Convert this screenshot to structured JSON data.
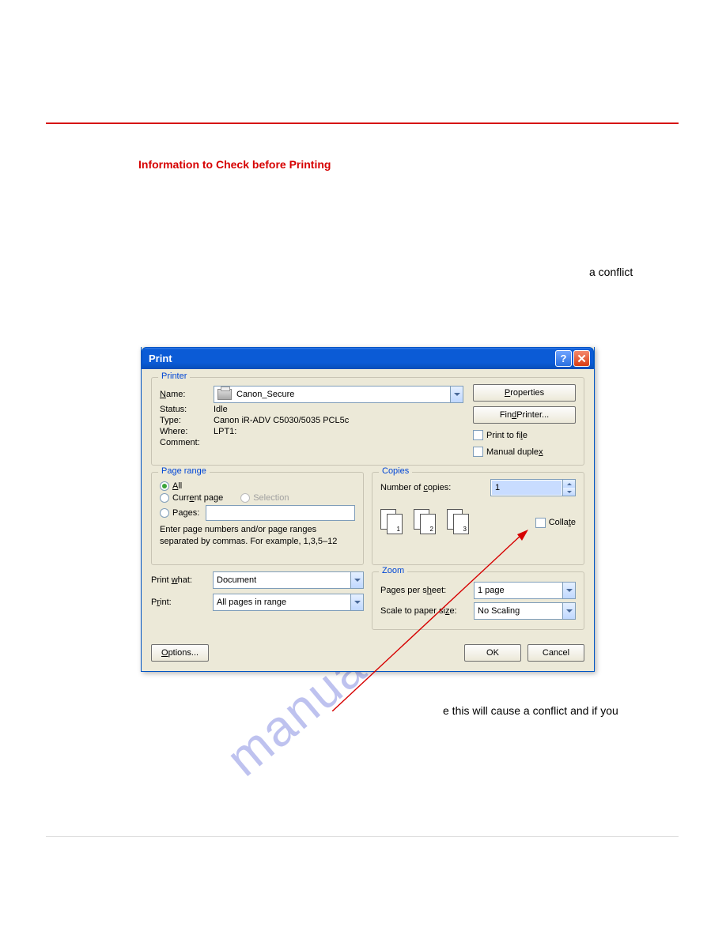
{
  "page": {
    "heading": "Information to Check before Printing",
    "fragment_right": "a conflict",
    "fragment_bottom": "e this will cause a conflict and if you",
    "watermark": "manualshive.com"
  },
  "dialog": {
    "title": "Print",
    "printer": {
      "legend": "Printer",
      "name_label": "Name:",
      "name_value": "Canon_Secure",
      "status_label": "Status:",
      "status_value": "Idle",
      "type_label": "Type:",
      "type_value": "Canon iR-ADV C5030/5035 PCL5c",
      "where_label": "Where:",
      "where_value": "LPT1:",
      "comment_label": "Comment:",
      "comment_value": "",
      "properties_btn": "Properties",
      "find_printer_btn": "Find Printer...",
      "print_to_file": "Print to file",
      "manual_duplex": "Manual duplex"
    },
    "page_range": {
      "legend": "Page range",
      "all": "All",
      "current": "Current page",
      "selection": "Selection",
      "pages": "Pages:",
      "pages_value": "",
      "hint": "Enter page numbers and/or page ranges separated by commas.  For example, 1,3,5–12"
    },
    "copies": {
      "legend": "Copies",
      "num_label": "Number of copies:",
      "num_value": "1",
      "collate": "Collate",
      "stack_a": "1",
      "stack_b": "2",
      "stack_c": "3"
    },
    "lower": {
      "print_what_label": "Print what:",
      "print_what_value": "Document",
      "print_label": "Print:",
      "print_value": "All pages in range"
    },
    "zoom": {
      "legend": "Zoom",
      "pps_label": "Pages per sheet:",
      "pps_value": "1 page",
      "scale_label": "Scale to paper size:",
      "scale_value": "No Scaling"
    },
    "buttons": {
      "options": "Options...",
      "ok": "OK",
      "cancel": "Cancel"
    }
  }
}
